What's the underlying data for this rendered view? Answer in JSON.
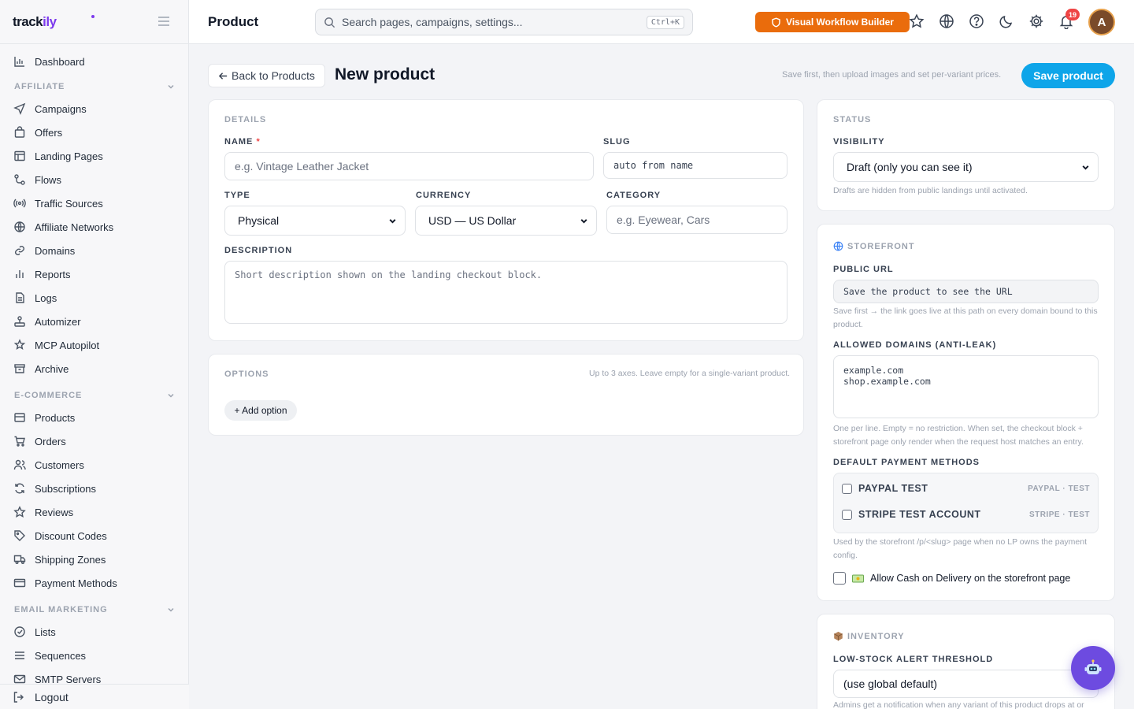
{
  "brand": {
    "name_a": "track",
    "name_b": "ily"
  },
  "page_title": "Product",
  "search": {
    "placeholder": "Search pages, campaigns, settings...",
    "shortcut": "Ctrl+K"
  },
  "topbar": {
    "workflow_button": "Visual Workflow Builder",
    "notification_count": "19",
    "avatar_initial": "A"
  },
  "sidebar": {
    "dashboard": "Dashboard",
    "group_affiliate": "AFFILIATE",
    "affiliate_items": [
      "Campaigns",
      "Offers",
      "Landing Pages",
      "Flows",
      "Traffic Sources",
      "Affiliate Networks",
      "Domains",
      "Reports",
      "Logs",
      "Automizer",
      "MCP Autopilot",
      "Archive"
    ],
    "group_ecommerce": "E-COMMERCE",
    "ecommerce_items": [
      "Products",
      "Orders",
      "Customers",
      "Subscriptions",
      "Reviews",
      "Discount Codes",
      "Shipping Zones",
      "Payment Methods"
    ],
    "group_email": "EMAIL MARKETING",
    "email_items": [
      "Lists",
      "Sequences",
      "SMTP Servers"
    ],
    "logout": "Logout"
  },
  "header": {
    "back_label": "Back to Products",
    "title": "New product",
    "hint": "Save first, then upload images and set per-variant prices.",
    "save_label": "Save product"
  },
  "details": {
    "section": "DETAILS",
    "name_label": "NAME",
    "name_placeholder": "e.g. Vintage Leather Jacket",
    "slug_label": "SLUG",
    "slug_placeholder": "auto from name",
    "type_label": "TYPE",
    "type_value": "Physical",
    "currency_label": "CURRENCY",
    "currency_value": "USD — US Dollar",
    "category_label": "CATEGORY",
    "category_placeholder": "e.g. Eyewear, Cars",
    "description_label": "DESCRIPTION",
    "description_placeholder": "Short description shown on the landing checkout block."
  },
  "options": {
    "section": "OPTIONS",
    "hint": "Up to 3 axes. Leave empty for a single-variant product.",
    "add_label": "+ Add option"
  },
  "status": {
    "section": "STATUS",
    "visibility_label": "VISIBILITY",
    "visibility_value": "Draft (only you can see it)",
    "visibility_help": "Drafts are hidden from public landings until activated."
  },
  "storefront": {
    "section": "STOREFRONT",
    "url_label": "PUBLIC URL",
    "url_placeholder": "Save the product to see the URL",
    "url_help": "Save first → the link goes live at this path on every domain bound to this product.",
    "domains_label": "ALLOWED DOMAINS (ANTI-LEAK)",
    "domains_placeholder": "example.com\nshop.example.com",
    "domains_help": "One per line. Empty = no restriction. When set, the checkout block + storefront page only render when the request host matches an entry.",
    "payment_label": "DEFAULT PAYMENT METHODS",
    "payment_methods": [
      {
        "name": "PAYPAL TEST",
        "tag": "PAYPAL · TEST"
      },
      {
        "name": "STRIPE TEST ACCOUNT",
        "tag": "STRIPE · TEST"
      }
    ],
    "payment_help": "Used by the storefront /p/<slug> page when no LP owns the payment config.",
    "cod_label": "Allow Cash on Delivery on the storefront page"
  },
  "inventory": {
    "section": "INVENTORY",
    "threshold_label": "LOW-STOCK ALERT THRESHOLD",
    "threshold_placeholder": "(use global default)",
    "threshold_help": "Admins get a notification when any variant of this product drops at or"
  },
  "colors": {
    "accent": "#0ea5e9",
    "brand": "#7c3aed",
    "warning": "#ea6c0c",
    "danger": "#ef4444"
  }
}
